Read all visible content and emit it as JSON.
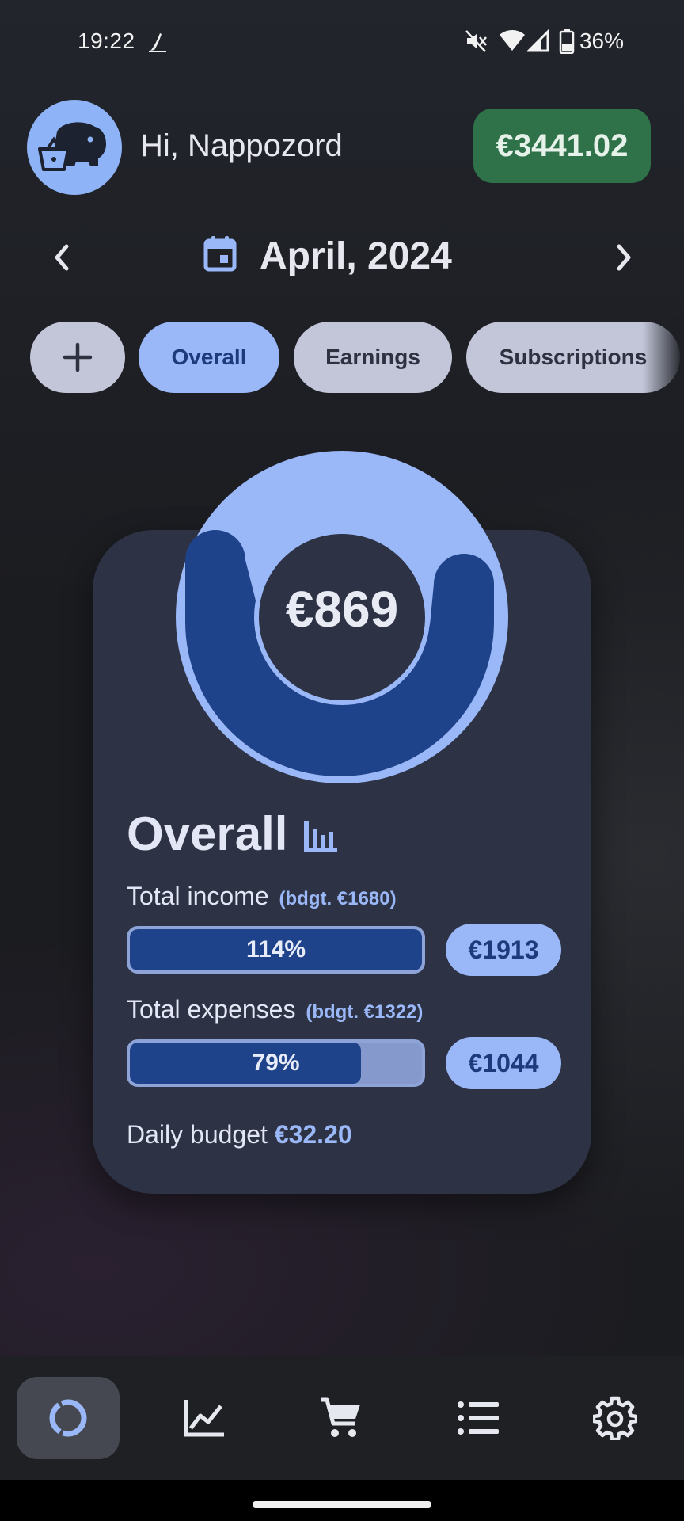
{
  "status_bar": {
    "time": "19:22",
    "battery": "36%",
    "icons": [
      "app-notification-icon",
      "mute-icon",
      "wifi-icon",
      "signal-icon",
      "battery-icon"
    ]
  },
  "header": {
    "greeting": "Hi, Nappozord",
    "balance": "€3441.02",
    "avatar_icon": "piggy-bank-icon"
  },
  "month_nav": {
    "label": "April, 2024",
    "prev_icon": "chevron-left-icon",
    "next_icon": "chevron-right-icon",
    "calendar_icon": "calendar-icon"
  },
  "chips": [
    {
      "label": "",
      "icon": "plus-icon"
    },
    {
      "label": "Overall",
      "active": true
    },
    {
      "label": "Earnings"
    },
    {
      "label": "Subscriptions"
    }
  ],
  "card": {
    "donut_value": "€869",
    "title": "Overall",
    "title_icon": "bar-chart-icon",
    "income": {
      "label": "Total income",
      "budget": "(bdgt. €1680)",
      "percent_text": "114%",
      "fill_fraction": 1.0,
      "amount": "€1913"
    },
    "expenses": {
      "label": "Total expenses",
      "budget": "(bdgt. €1322)",
      "percent_text": "79%",
      "fill_fraction": 0.79,
      "amount": "€1044"
    },
    "daily_label": "Daily budget",
    "daily_value": "€32.20"
  },
  "bottom_nav": [
    {
      "icon": "donut-chart-icon",
      "active": true
    },
    {
      "icon": "line-chart-icon"
    },
    {
      "icon": "cart-icon"
    },
    {
      "icon": "list-icon"
    },
    {
      "icon": "gear-icon"
    }
  ],
  "colors": {
    "accent": "#9ab8f8",
    "accent_dark": "#1e438a",
    "balance_green": "#2f7249",
    "card": "#2d3244"
  }
}
